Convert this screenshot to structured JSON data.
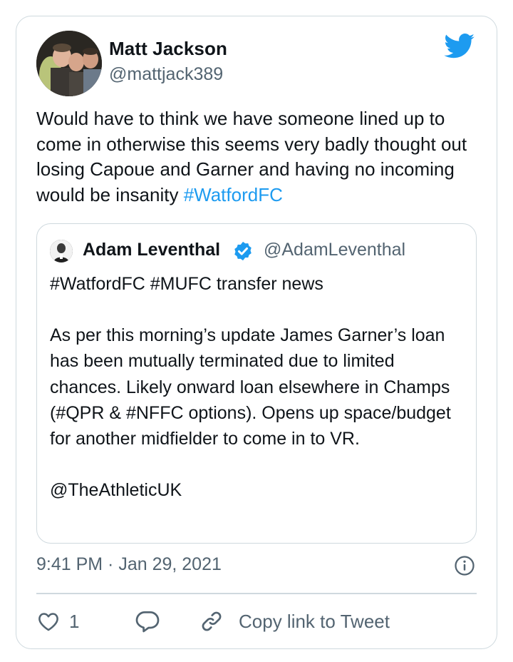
{
  "tweet": {
    "author_name": "Matt Jackson",
    "author_handle": "@mattjack389",
    "text_before": "Would have to think we have someone lined up to come in otherwise this seems very badly thought out losing Capoue and Garner and having no incoming would be insanity ",
    "hashtag": "#WatfordFC",
    "timestamp": "9:41 PM · Jan 29, 2021",
    "like_count": "1",
    "copy_link_label": "Copy link to Tweet"
  },
  "quoted_tweet": {
    "author_name": "Adam Leventhal",
    "author_handle": "@AdamLeventhal",
    "paragraphs": [
      "#WatfordFC #MUFC transfer news",
      "As per this morning’s update James Garner’s loan has been mutually terminated due to limited chances. Likely onward loan elsewhere in Champs (#QPR & #NFFC options). Opens up space/budget for another midfielder to come in to VR.",
      "@TheAthleticUK"
    ]
  },
  "icons": {
    "brand": "twitter-bird-icon",
    "verified": "verified-badge-icon",
    "info": "info-icon",
    "like": "heart-icon",
    "reply": "reply-bubble-icon",
    "link": "link-icon"
  },
  "colors": {
    "accent": "#1d9bf0",
    "secondary_text": "#536471",
    "border": "#cfd9de",
    "primary_text": "#0f1419"
  }
}
